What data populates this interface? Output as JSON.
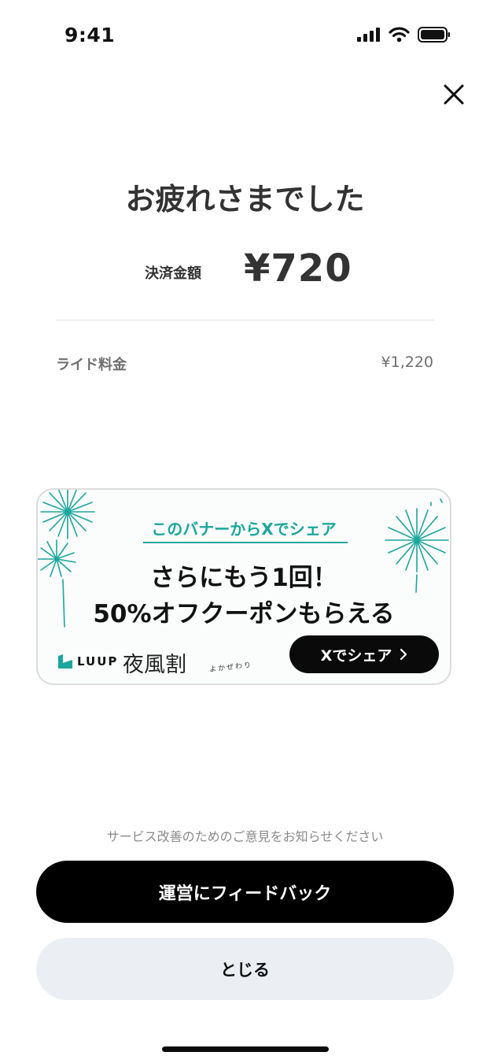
{
  "status_bar": {
    "time": "9:41",
    "icons": [
      "cellular-signal-icon",
      "wifi-icon",
      "battery-icon"
    ]
  },
  "header": {
    "close_icon": "close-icon"
  },
  "title": "お疲れさまでした",
  "payment": {
    "label": "決済金額",
    "amount": "¥720"
  },
  "fees": [
    {
      "label": "ライド料金",
      "value": "¥1,220"
    }
  ],
  "banner": {
    "headline": "このバナーからXでシェア",
    "main_line1": "さらにもう1回！",
    "main_line2": "50%オフクーポンもらえる",
    "logo_text": "LUUP",
    "campaign_name": "夜風割",
    "campaign_kana": "よかぜわり",
    "share_button": "Xでシェア",
    "accent_color": "#1aa69c"
  },
  "feedback": {
    "caption": "サービス改善のためのご意見をお知らせください",
    "button": "運営にフィードバック"
  },
  "close_button": "とじる"
}
